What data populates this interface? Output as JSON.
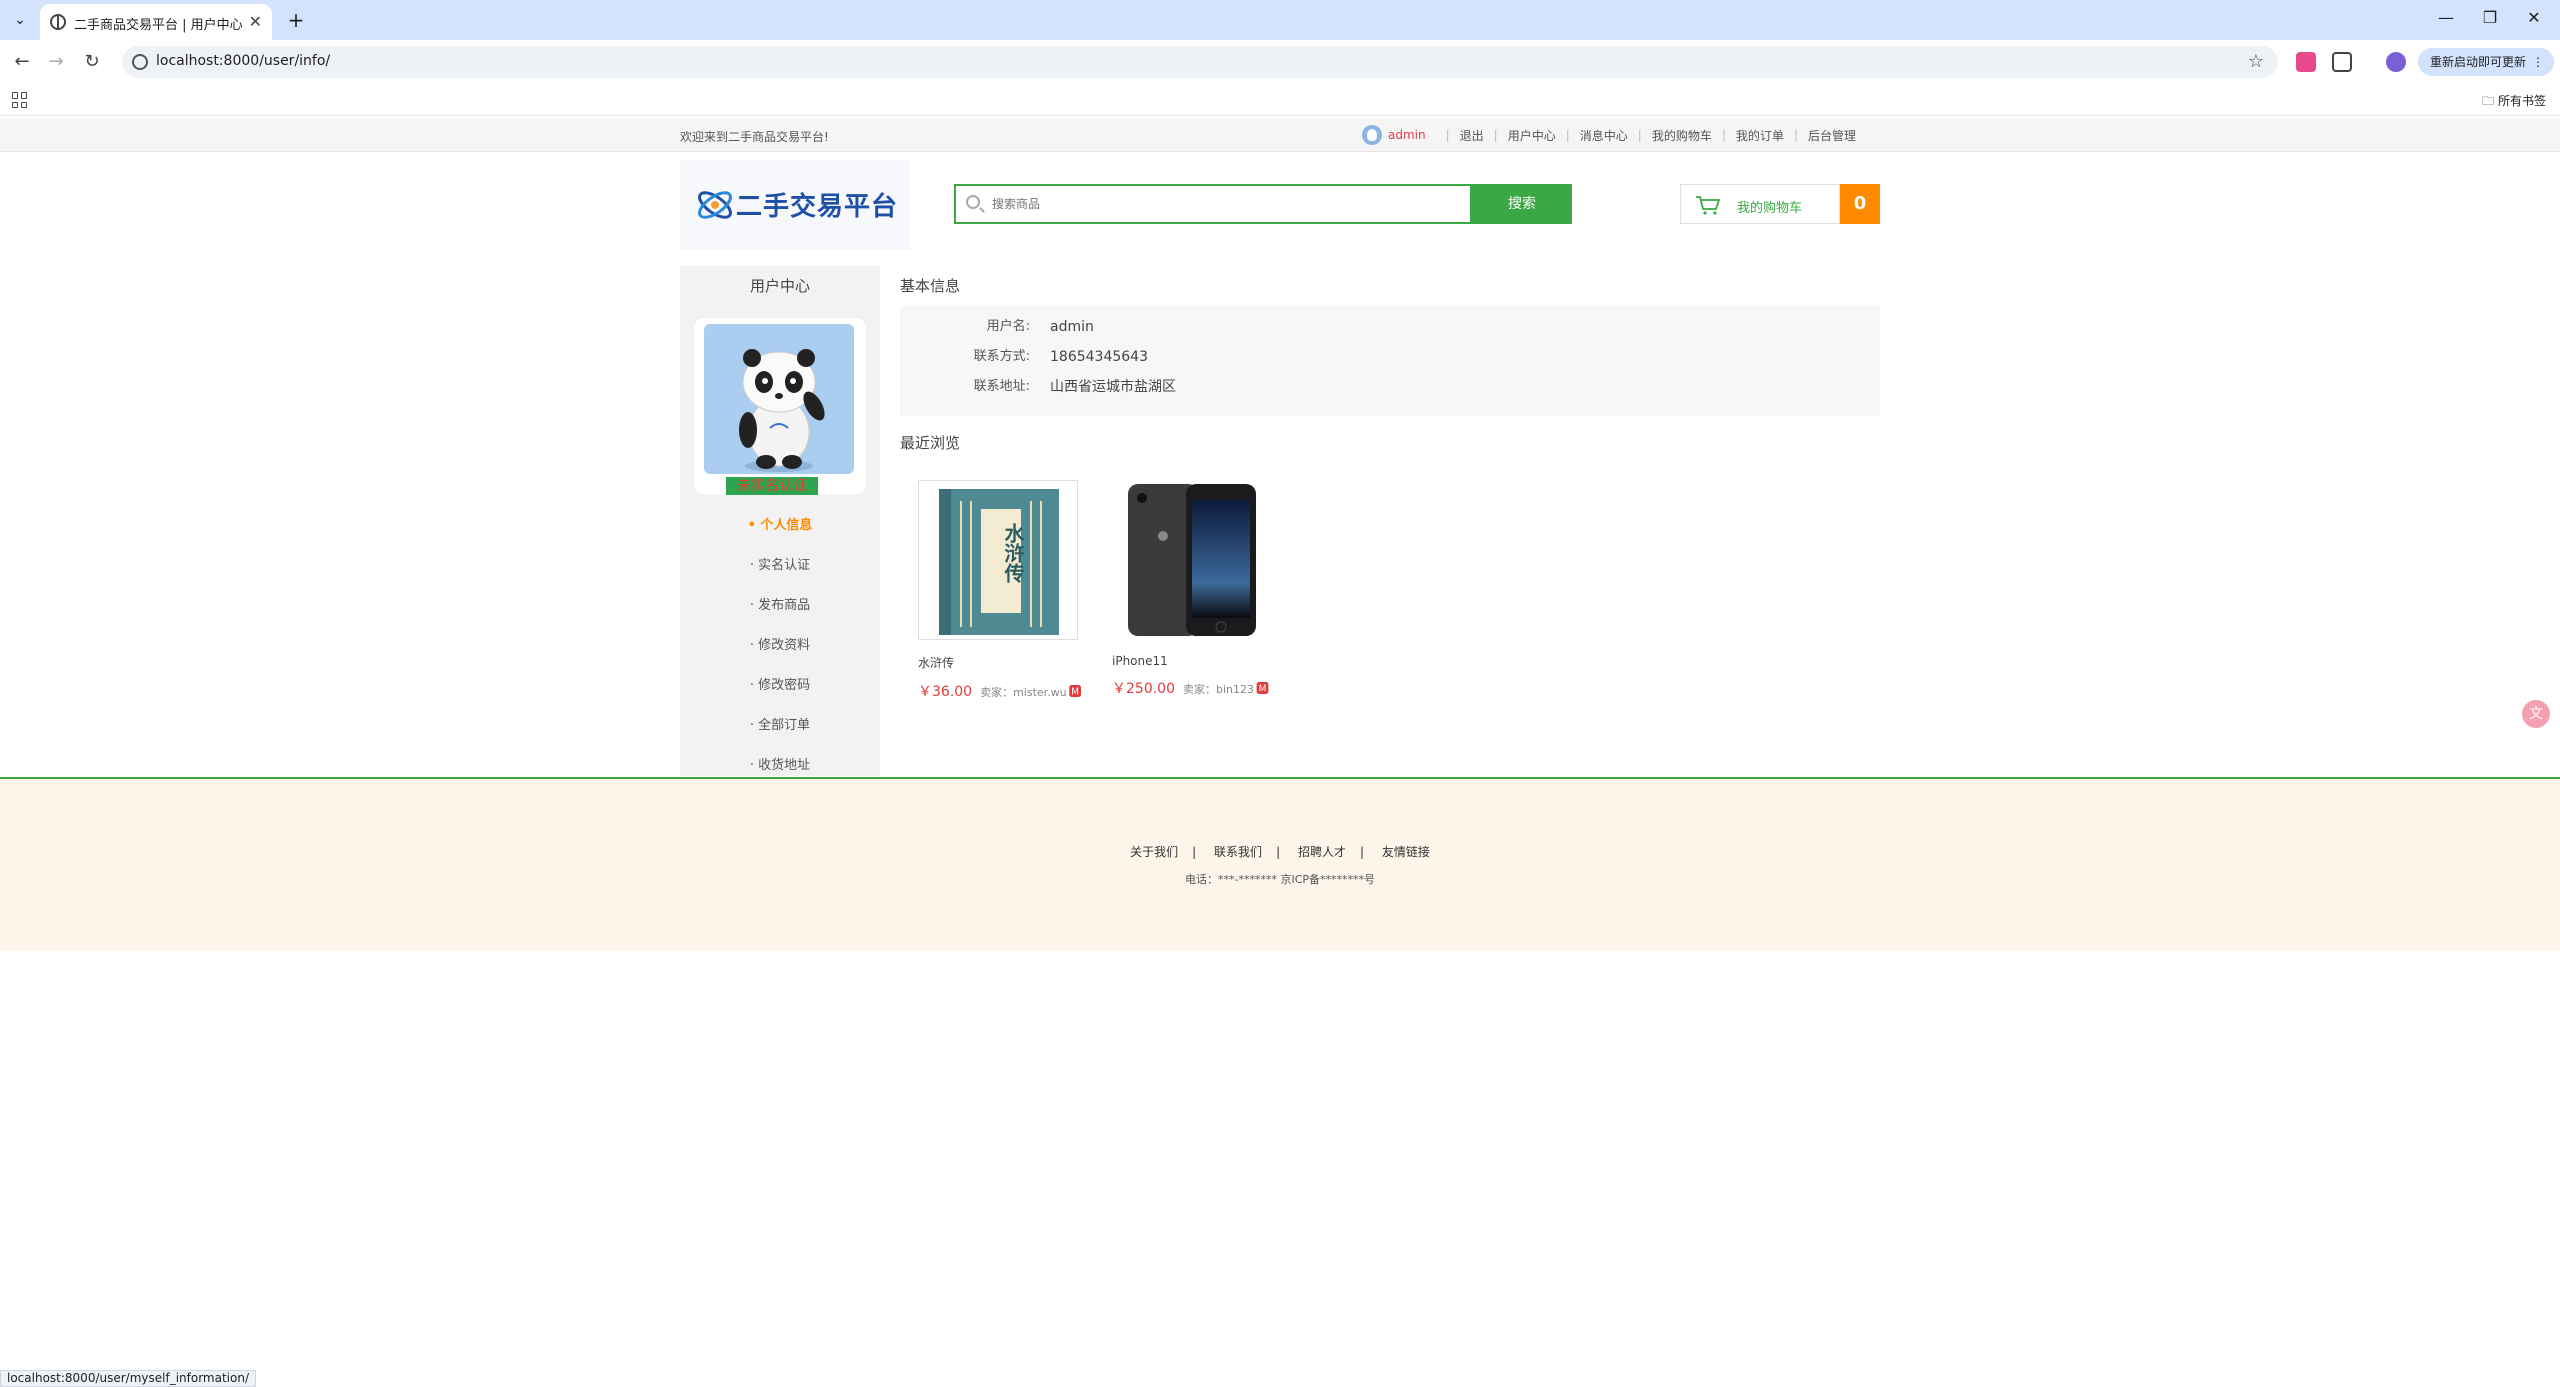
{
  "browser": {
    "tab_title": "二手商品交易平台 | 用户中心",
    "url": "localhost:8000/user/info/",
    "update_button": "重新启动即可更新",
    "all_bookmarks": "所有书签",
    "status_url": "localhost:8000/user/myself_information/"
  },
  "site_top": {
    "welcome": "欢迎来到二手商品交易平台!",
    "username": "admin",
    "links": [
      "退出",
      "用户中心",
      "消息中心",
      "我的购物车",
      "我的订单",
      "后台管理"
    ]
  },
  "header": {
    "logo_text": "二手交易平台",
    "search_placeholder": "搜索商品",
    "search_button": "搜索",
    "cart_label": "我的购物车",
    "cart_count": "0"
  },
  "sidebar": {
    "title": "用户中心",
    "verify_badge": "未实名认证",
    "menu": [
      "• 个人信息",
      "· 实名认证",
      "· 发布商品",
      "· 修改资料",
      "· 修改密码",
      "· 全部订单",
      "· 收货地址"
    ]
  },
  "profile": {
    "section_title": "基本信息",
    "rows": [
      {
        "label": "用户名:",
        "value": "admin"
      },
      {
        "label": "联系方式:",
        "value": "18654345643"
      },
      {
        "label": "联系地址:",
        "value": "山西省运城市盐湖区"
      }
    ]
  },
  "recent": {
    "title": "最近浏览",
    "items": [
      {
        "name": "水浒传",
        "price": "￥36.00",
        "seller": "卖家：mister.wu",
        "chat": "🅼",
        "cover_text": "水浒传"
      },
      {
        "name": "iPhone11",
        "price": "￥250.00",
        "seller": "卖家：bin123",
        "chat": "🅼"
      }
    ]
  },
  "footer": {
    "links": [
      "关于我们",
      "联系我们",
      "招聘人才",
      "友情链接"
    ],
    "icp": "电话：***-******* 京ICP备********号"
  },
  "colors": {
    "brand_green": "#3aa844",
    "accent_orange": "#ff8a00",
    "price_red": "#e4393c"
  }
}
